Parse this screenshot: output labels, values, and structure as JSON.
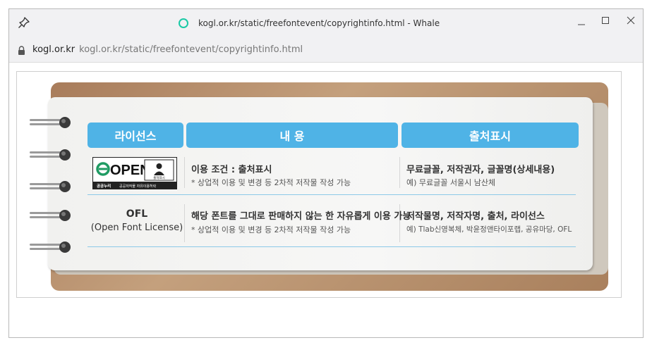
{
  "window": {
    "title": "kogl.or.kr/static/freefontevent/copyrightinfo.html - Whale"
  },
  "address": {
    "domain": "kogl.or.kr",
    "path": "kogl.or.kr/static/freefontevent/copyrightinfo.html"
  },
  "table": {
    "headers": [
      "라이선스",
      "내 용",
      "출처표시"
    ],
    "rows": [
      {
        "license_logo": {
          "word": "OPEN",
          "badge": "출처표시",
          "caption_left": "공공누리",
          "caption_right": "공공저작물 자유이용허락"
        },
        "content_title": "이용 조건 : 출처표시",
        "content_sub": "* 상업적 이용 및 변경 등 2차적 저작물 작성 가능",
        "source_title": "무료글꼴, 저작권자, 글꼴명(상세내용)",
        "source_sub": "예) 무료글꼴 서울시 남산체"
      },
      {
        "license_name": "OFL",
        "license_full": "(Open Font License)",
        "content_title": "해당 폰트를 그대로 판매하지 않는 한 자유롭게 이용 가능",
        "content_sub": "* 상업적 이용 및 변경 등 2차적 저작물 작성 가능",
        "source_title": "저작물명, 저작자명, 출처, 라이선스",
        "source_sub": "예) Tlab신영복체, 박윤정앤타이포랩, 공유마당, OFL"
      }
    ]
  },
  "colors": {
    "header_bg": "#4fb3e6",
    "board_brown": "#b08a68",
    "loading_ring": "#19c9a5"
  },
  "icons": [
    "pin-icon",
    "loading-icon",
    "minimize-icon",
    "maximize-icon",
    "close-icon",
    "lock-icon",
    "ring-binder-icon"
  ]
}
